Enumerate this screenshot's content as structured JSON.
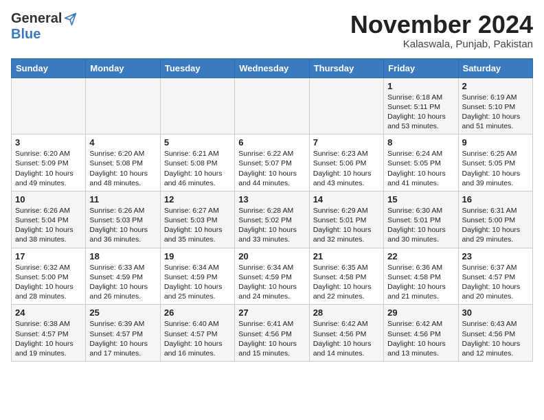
{
  "header": {
    "logo_general": "General",
    "logo_blue": "Blue",
    "month_title": "November 2024",
    "location": "Kalaswala, Punjab, Pakistan"
  },
  "days_of_week": [
    "Sunday",
    "Monday",
    "Tuesday",
    "Wednesday",
    "Thursday",
    "Friday",
    "Saturday"
  ],
  "weeks": [
    [
      {
        "day": "",
        "info": ""
      },
      {
        "day": "",
        "info": ""
      },
      {
        "day": "",
        "info": ""
      },
      {
        "day": "",
        "info": ""
      },
      {
        "day": "",
        "info": ""
      },
      {
        "day": "1",
        "info": "Sunrise: 6:18 AM\nSunset: 5:11 PM\nDaylight: 10 hours and 53 minutes."
      },
      {
        "day": "2",
        "info": "Sunrise: 6:19 AM\nSunset: 5:10 PM\nDaylight: 10 hours and 51 minutes."
      }
    ],
    [
      {
        "day": "3",
        "info": "Sunrise: 6:20 AM\nSunset: 5:09 PM\nDaylight: 10 hours and 49 minutes."
      },
      {
        "day": "4",
        "info": "Sunrise: 6:20 AM\nSunset: 5:08 PM\nDaylight: 10 hours and 48 minutes."
      },
      {
        "day": "5",
        "info": "Sunrise: 6:21 AM\nSunset: 5:08 PM\nDaylight: 10 hours and 46 minutes."
      },
      {
        "day": "6",
        "info": "Sunrise: 6:22 AM\nSunset: 5:07 PM\nDaylight: 10 hours and 44 minutes."
      },
      {
        "day": "7",
        "info": "Sunrise: 6:23 AM\nSunset: 5:06 PM\nDaylight: 10 hours and 43 minutes."
      },
      {
        "day": "8",
        "info": "Sunrise: 6:24 AM\nSunset: 5:05 PM\nDaylight: 10 hours and 41 minutes."
      },
      {
        "day": "9",
        "info": "Sunrise: 6:25 AM\nSunset: 5:05 PM\nDaylight: 10 hours and 39 minutes."
      }
    ],
    [
      {
        "day": "10",
        "info": "Sunrise: 6:26 AM\nSunset: 5:04 PM\nDaylight: 10 hours and 38 minutes."
      },
      {
        "day": "11",
        "info": "Sunrise: 6:26 AM\nSunset: 5:03 PM\nDaylight: 10 hours and 36 minutes."
      },
      {
        "day": "12",
        "info": "Sunrise: 6:27 AM\nSunset: 5:03 PM\nDaylight: 10 hours and 35 minutes."
      },
      {
        "day": "13",
        "info": "Sunrise: 6:28 AM\nSunset: 5:02 PM\nDaylight: 10 hours and 33 minutes."
      },
      {
        "day": "14",
        "info": "Sunrise: 6:29 AM\nSunset: 5:01 PM\nDaylight: 10 hours and 32 minutes."
      },
      {
        "day": "15",
        "info": "Sunrise: 6:30 AM\nSunset: 5:01 PM\nDaylight: 10 hours and 30 minutes."
      },
      {
        "day": "16",
        "info": "Sunrise: 6:31 AM\nSunset: 5:00 PM\nDaylight: 10 hours and 29 minutes."
      }
    ],
    [
      {
        "day": "17",
        "info": "Sunrise: 6:32 AM\nSunset: 5:00 PM\nDaylight: 10 hours and 28 minutes."
      },
      {
        "day": "18",
        "info": "Sunrise: 6:33 AM\nSunset: 4:59 PM\nDaylight: 10 hours and 26 minutes."
      },
      {
        "day": "19",
        "info": "Sunrise: 6:34 AM\nSunset: 4:59 PM\nDaylight: 10 hours and 25 minutes."
      },
      {
        "day": "20",
        "info": "Sunrise: 6:34 AM\nSunset: 4:59 PM\nDaylight: 10 hours and 24 minutes."
      },
      {
        "day": "21",
        "info": "Sunrise: 6:35 AM\nSunset: 4:58 PM\nDaylight: 10 hours and 22 minutes."
      },
      {
        "day": "22",
        "info": "Sunrise: 6:36 AM\nSunset: 4:58 PM\nDaylight: 10 hours and 21 minutes."
      },
      {
        "day": "23",
        "info": "Sunrise: 6:37 AM\nSunset: 4:57 PM\nDaylight: 10 hours and 20 minutes."
      }
    ],
    [
      {
        "day": "24",
        "info": "Sunrise: 6:38 AM\nSunset: 4:57 PM\nDaylight: 10 hours and 19 minutes."
      },
      {
        "day": "25",
        "info": "Sunrise: 6:39 AM\nSunset: 4:57 PM\nDaylight: 10 hours and 17 minutes."
      },
      {
        "day": "26",
        "info": "Sunrise: 6:40 AM\nSunset: 4:57 PM\nDaylight: 10 hours and 16 minutes."
      },
      {
        "day": "27",
        "info": "Sunrise: 6:41 AM\nSunset: 4:56 PM\nDaylight: 10 hours and 15 minutes."
      },
      {
        "day": "28",
        "info": "Sunrise: 6:42 AM\nSunset: 4:56 PM\nDaylight: 10 hours and 14 minutes."
      },
      {
        "day": "29",
        "info": "Sunrise: 6:42 AM\nSunset: 4:56 PM\nDaylight: 10 hours and 13 minutes."
      },
      {
        "day": "30",
        "info": "Sunrise: 6:43 AM\nSunset: 4:56 PM\nDaylight: 10 hours and 12 minutes."
      }
    ]
  ]
}
